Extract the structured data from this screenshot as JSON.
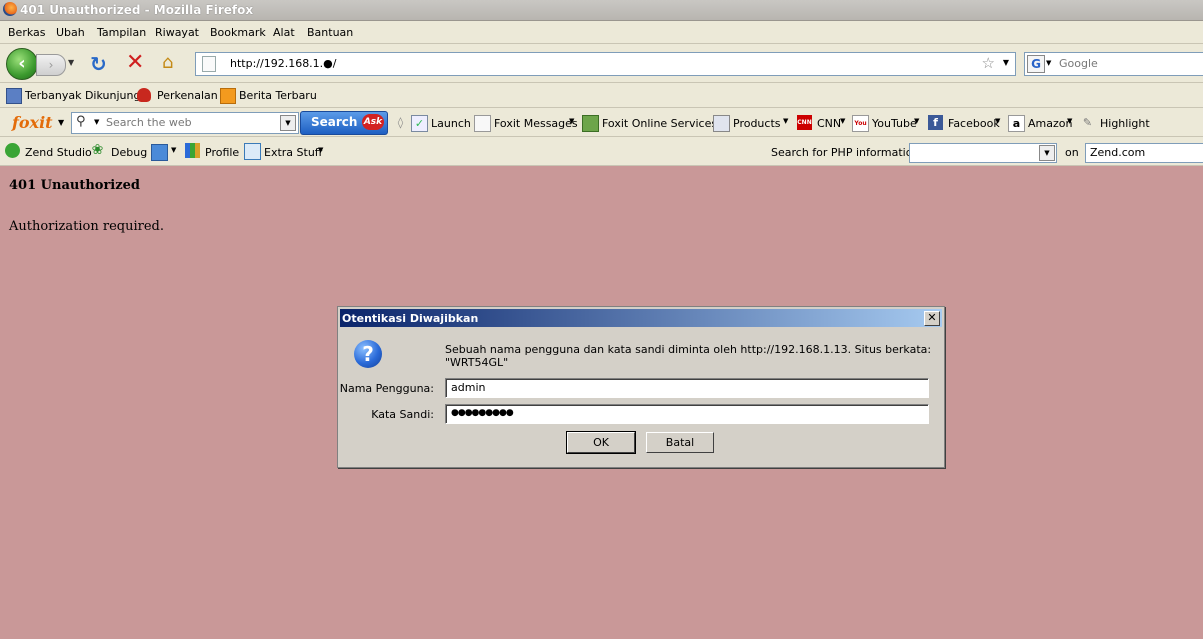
{
  "window": {
    "title": "401 Unauthorized - Mozilla Firefox"
  },
  "menu": [
    "Berkas",
    "Ubah",
    "Tampilan",
    "Riwayat",
    "Bookmark",
    "Alat",
    "Bantuan"
  ],
  "nav": {
    "url": "http://192.168.1.●/",
    "search_engine_letter": "G",
    "search_placeholder": "Google"
  },
  "bookmarks": [
    "Terbanyak Dikunjungi",
    "Perkenalan",
    "Berita Terbaru"
  ],
  "foxit": {
    "logo": "foxit",
    "search_placeholder": "Search the web",
    "search_button": "Search",
    "ask_label": "Ask",
    "items": [
      "Launch",
      "Foxit Messages",
      "Foxit Online Services",
      "Products",
      "CNN",
      "YouTube",
      "Facebook",
      "Amazon",
      "Highlight"
    ]
  },
  "zend": {
    "items": [
      "Zend Studio",
      "Debug",
      "Profile",
      "Extra Stuff"
    ],
    "php_label": "Search for PHP information:",
    "on_label": "on",
    "site": "Zend.com"
  },
  "page": {
    "heading": "401 Unauthorized",
    "body": "Authorization required."
  },
  "dialog": {
    "title": "Otentikasi Diwajibkan",
    "message": "Sebuah nama pengguna dan kata sandi diminta oleh http://192.168.1.13. Situs berkata: \"WRT54GL\"",
    "username_label": "Nama Pengguna:",
    "username_value": "admin",
    "password_label": "Kata Sandi:",
    "password_value": "●●●●●●●●●",
    "ok": "OK",
    "cancel": "Batal"
  }
}
